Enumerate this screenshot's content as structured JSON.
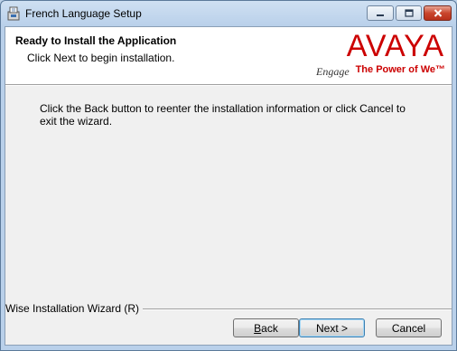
{
  "window": {
    "title": "French Language Setup",
    "icons": {
      "app": "installer-icon",
      "minimize": "minimize-icon",
      "maximize": "maximize-icon",
      "close": "close-icon"
    }
  },
  "banner": {
    "title": "Ready to Install the Application",
    "subtitle": "Click Next to begin installation.",
    "logo": {
      "wordmark": "AVAYA",
      "tagline_script": "Engage",
      "tagline": "The Power of We™",
      "brand_color": "#cc0000"
    }
  },
  "body": {
    "text": "Click the Back button to reenter the installation information or click Cancel to exit the wizard."
  },
  "footer": {
    "brand": "Wise Installation Wizard (R)",
    "buttons": {
      "back": {
        "pre": "",
        "mnemonic": "B",
        "post": "ack"
      },
      "next": "Next >",
      "cancel": "Cancel"
    }
  }
}
